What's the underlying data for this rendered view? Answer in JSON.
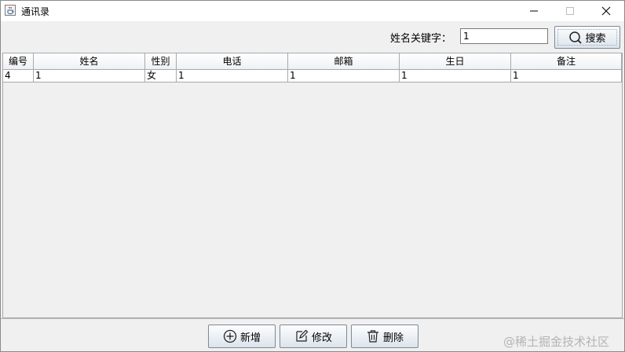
{
  "window": {
    "title": "通讯录"
  },
  "search": {
    "label": "姓名关键字：",
    "value": "1",
    "button_label": "搜索"
  },
  "table": {
    "columns": [
      "编号",
      "姓名",
      "性别",
      "电话",
      "邮箱",
      "生日",
      "备注"
    ],
    "rows": [
      [
        "4",
        "1",
        "女",
        "1",
        "1",
        "1",
        "1"
      ]
    ]
  },
  "actions": {
    "add_label": "新增",
    "edit_label": "修改",
    "delete_label": "删除"
  },
  "watermark": "@稀土掘金技术社区",
  "icons": {
    "app": "java-app-icon",
    "search": "magnifier-icon",
    "add": "plus-circle-icon",
    "edit": "pencil-icon",
    "delete": "trash-icon"
  }
}
